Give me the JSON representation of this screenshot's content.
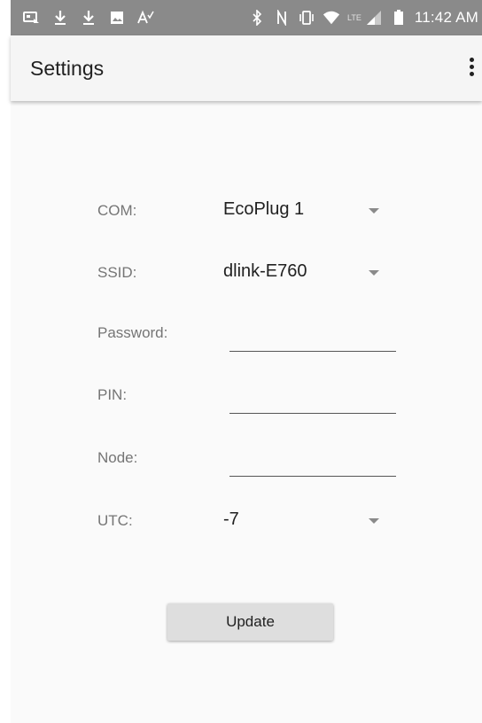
{
  "status_bar": {
    "time": "11:42 AM",
    "network_label": "LTE",
    "left_icons": [
      "notification-card-icon",
      "download-icon",
      "download-icon",
      "image-icon",
      "spellcheck-icon"
    ],
    "right_icons": [
      "bluetooth-icon",
      "nfc-icon",
      "vibrate-icon",
      "wifi-icon",
      "signal-icon",
      "battery-icon"
    ]
  },
  "app_bar": {
    "title": "Settings",
    "overflow_icon": "more-vert-icon"
  },
  "form": {
    "com": {
      "label": "COM:",
      "value": "EcoPlug 1"
    },
    "ssid": {
      "label": "SSID:",
      "value": "dlink-E760"
    },
    "password": {
      "label": "Password:",
      "value": ""
    },
    "pin": {
      "label": "PIN:",
      "value": ""
    },
    "node": {
      "label": "Node:",
      "value": ""
    },
    "utc": {
      "label": "UTC:",
      "value": "-7"
    }
  },
  "update_button": {
    "label": "Update"
  },
  "colors": {
    "status_bar_bg": "#8a8a8a",
    "app_bar_bg": "#f5f5f5",
    "page_bg": "#fafafa",
    "label_text": "#757575",
    "value_text": "#212121",
    "button_bg": "#dedede"
  }
}
